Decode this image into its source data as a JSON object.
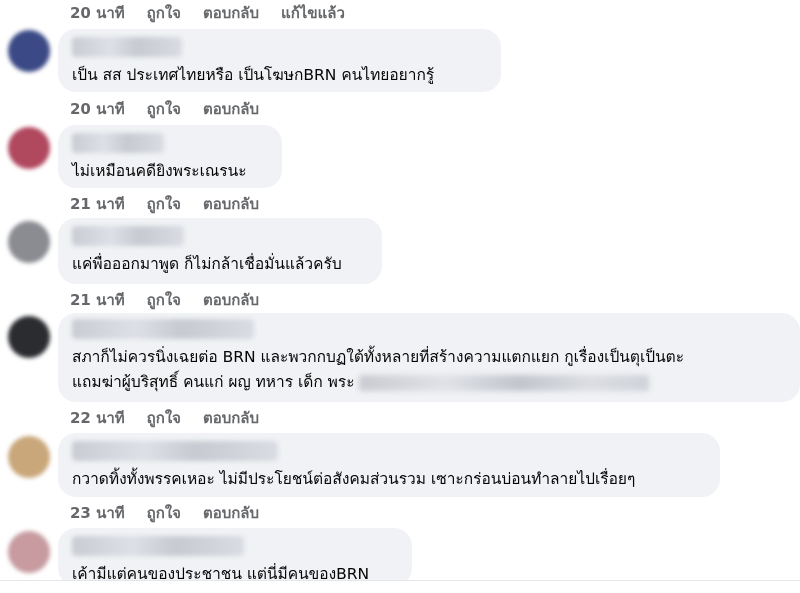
{
  "top_meta": {
    "time": "20 นาที",
    "like": "ถูกใจ",
    "reply": "ตอบกลับ",
    "edited": "แก้ไขแล้ว"
  },
  "comments": [
    {
      "text": "เป็น สส ประเทศไทยหรือ เป็นโฆษกBRN คนไทยอยากรู้",
      "time": "20 นาที",
      "like": "ถูกใจ",
      "reply": "ตอบกลับ",
      "avatar_color": "#3b4a86"
    },
    {
      "text": "ไม่เหมือนคดียิงพระเณรนะ",
      "time": "21 นาที",
      "like": "ถูกใจ",
      "reply": "ตอบกลับ",
      "avatar_color": "#b0485e"
    },
    {
      "text": "แค่พื่อออกมาพูด ก็ไม่กล้าเชื่อมั่นแล้วครับ",
      "time": "21 นาที",
      "like": "ถูกใจ",
      "reply": "ตอบกลับ",
      "avatar_color": "#8a8c92"
    },
    {
      "text": "สภาก็ไม่ควรนิ่งเฉยต่อ BRN และพวกกบฏใต้ทั้งหลายที่สร้างความแตกแยก กูเรื่องเป็นตุเป็นตะ",
      "text2": "แถมฆ่าผู้บริสุทธิ์ คนแก่ ผญ ทหาร เด็ก พระ",
      "time": "22 นาที",
      "like": "ถูกใจ",
      "reply": "ตอบกลับ",
      "avatar_color": "#2a2c30"
    },
    {
      "text": "กวาดทิ้งทั้งพรรคเหอะ ไม่มีประโยชน์ต่อสังคมส่วนรวม เซาะกร่อนบ่อนทำลายไปเรื่อยๆ",
      "time": "23 นาที",
      "like": "ถูกใจ",
      "reply": "ตอบกลับ",
      "avatar_color": "#c9a77a"
    },
    {
      "text": "เค้ามีแต่คนของประชาชน แต่นี่มีคนของBRN",
      "avatar_color": "#c79ba0"
    }
  ]
}
